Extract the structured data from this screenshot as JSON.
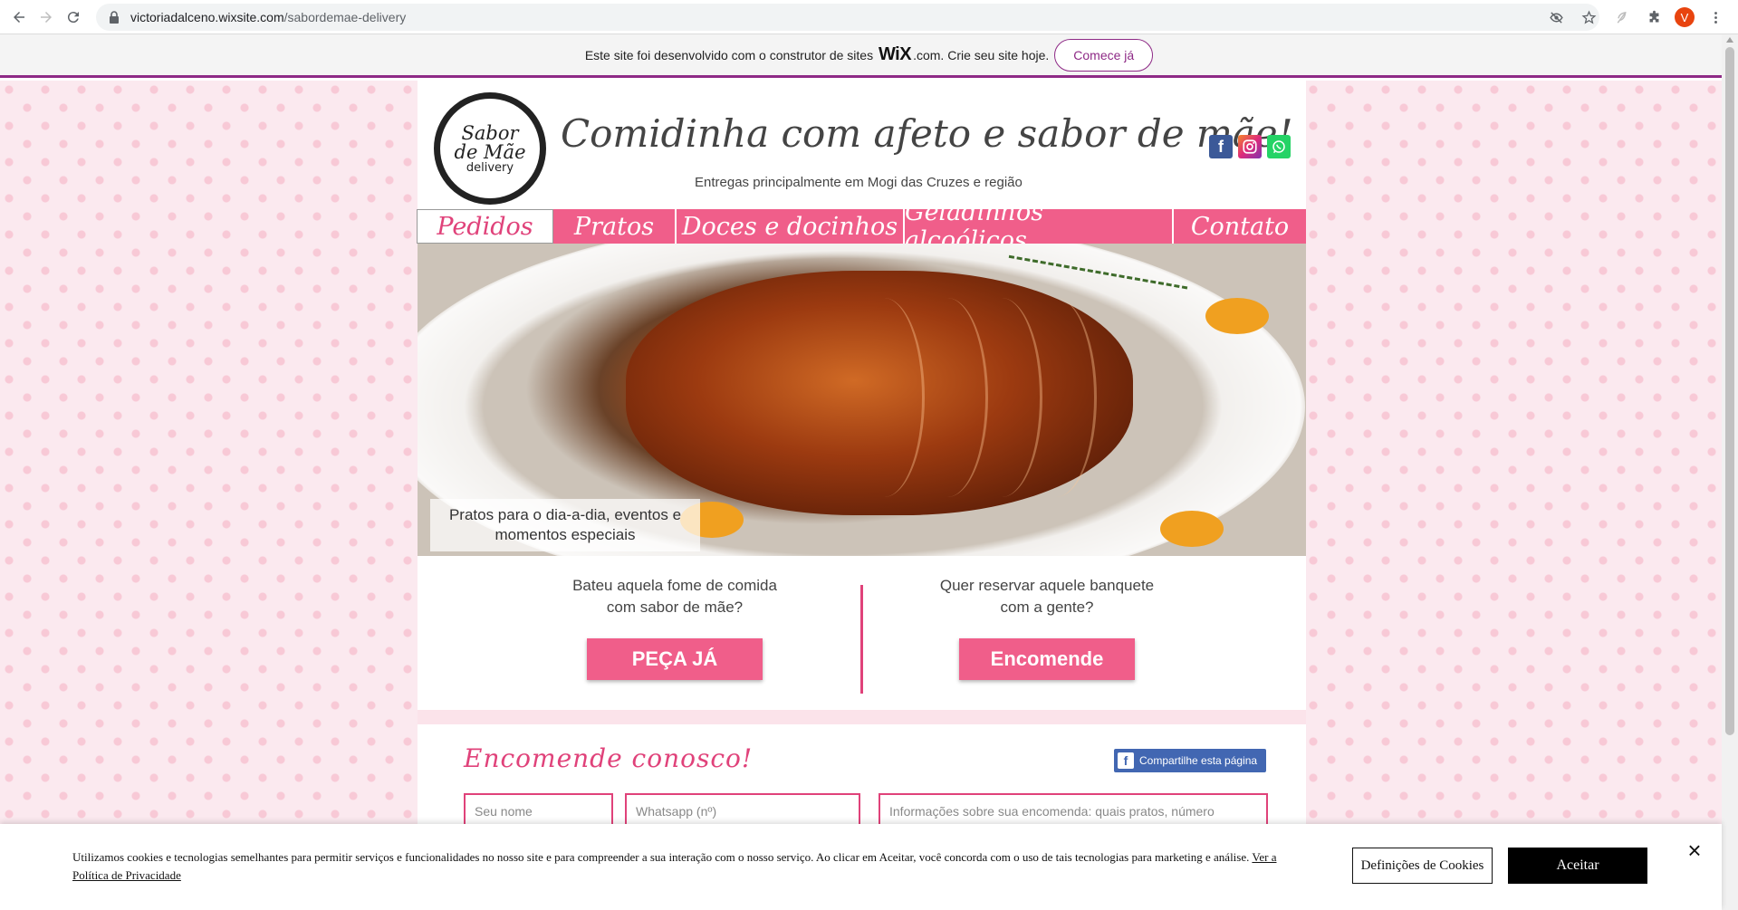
{
  "browser": {
    "url_host": "victoriadalceno.wixsite.com",
    "url_path": "/sabordemae-delivery",
    "profile_initial": "V"
  },
  "wix_banner": {
    "text_before": "Este site foi desenvolvido com o construtor de sites",
    "logo": "WiX",
    "text_after": ".com. Crie seu site hoje.",
    "button": "Comece já"
  },
  "header": {
    "logo_line1": "Sabor",
    "logo_line2": "de Mãe",
    "logo_line3": "delivery",
    "title": "Comidinha com afeto e sabor de mãe!",
    "subtitle": "Entregas principalmente em Mogi das Cruzes e região",
    "social": [
      "facebook",
      "instagram",
      "whatsapp"
    ]
  },
  "menu": {
    "items": [
      {
        "label": "Pedidos",
        "active": true
      },
      {
        "label": "Pratos",
        "active": false
      },
      {
        "label": "Doces e docinhos",
        "active": false
      },
      {
        "label": "Geladinhos alcoólicos",
        "active": false
      },
      {
        "label": "Contato",
        "active": false
      }
    ]
  },
  "hero": {
    "caption": "Pratos para o dia-a-dia, eventos e momentos especiais"
  },
  "cta": {
    "left_text_1": "Bateu aquela fome de comida",
    "left_text_2": "com sabor de mãe?",
    "left_button": "PEÇA JÁ",
    "right_text_1": "Quer reservar aquele banquete",
    "right_text_2": "com a gente?",
    "right_button": "Encomende"
  },
  "order_form": {
    "title": "Encomende conosco!",
    "share_button": "Compartilhe esta página",
    "name_placeholder": "Seu nome",
    "whatsapp_placeholder": "Whatsapp (nº)",
    "info_placeholder": "Informações sobre sua encomenda: quais pratos, número"
  },
  "cookie_bar": {
    "text": "Utilizamos cookies e tecnologias semelhantes para permitir serviços e funcionalidades no nosso site e para compreender a sua interação com o nosso serviço. Ao clicar em Aceitar, você concorda com o uso de tais tecnologias para marketing e análise.",
    "link": "Ver a Política de Privacidade",
    "settings_button": "Definições de Cookies",
    "accept_button": "Aceitar"
  },
  "colors": {
    "accent_pink": "#f05e8a",
    "wix_purple": "#8e2a86",
    "title_pink": "#e0427a"
  }
}
